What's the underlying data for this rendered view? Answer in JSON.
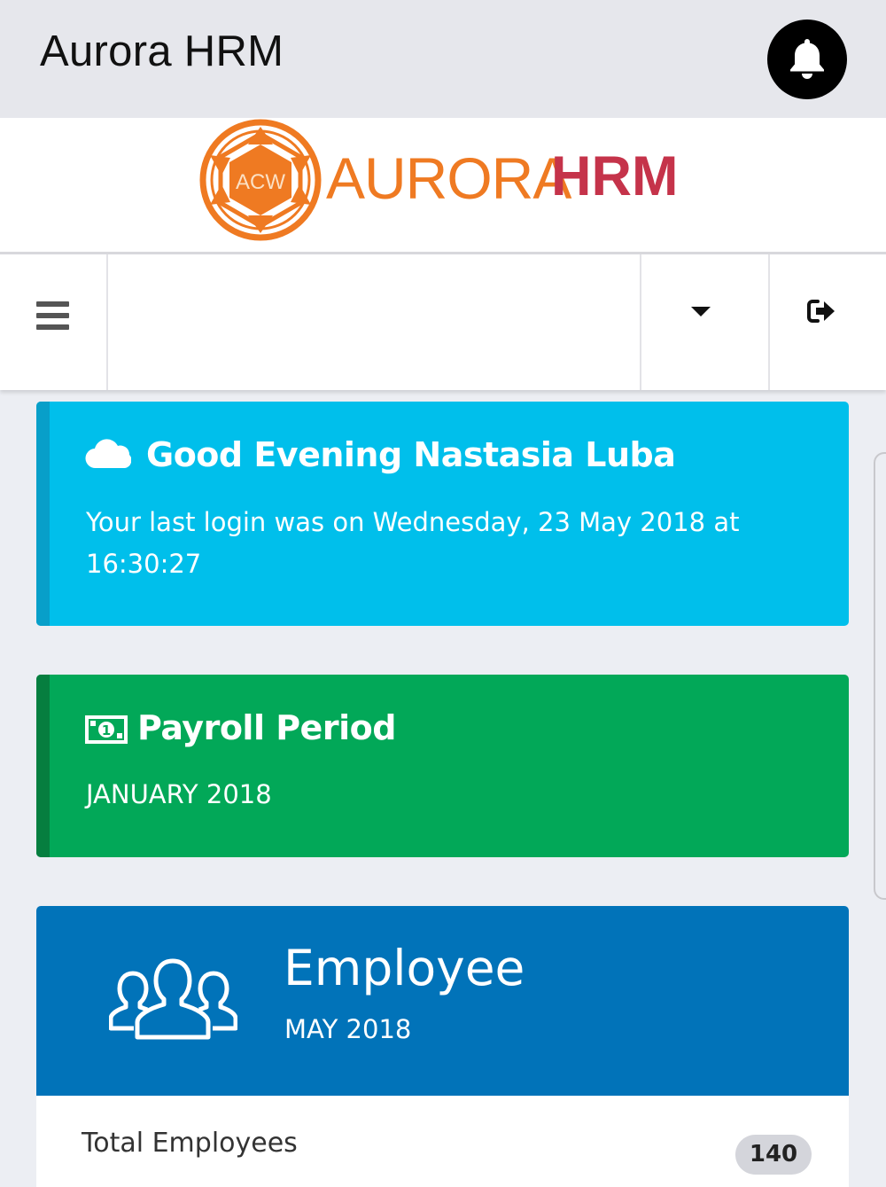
{
  "appbar": {
    "title": "Aurora HRM",
    "notification_icon": "bell-icon"
  },
  "logo": {
    "emblem_text": "ACW",
    "text_primary": "AURORA",
    "text_secondary": "HRM"
  },
  "navbar": {
    "menu_icon": "menu-icon",
    "dropdown_icon": "caret-down-icon",
    "logout_icon": "sign-out-icon"
  },
  "welcome": {
    "icon": "cloud-icon",
    "title": "Good Evening Nastasia Luba",
    "message": "Your last login was on Wednesday, 23 May 2018 at 16:30:27"
  },
  "payroll": {
    "icon": "money-icon",
    "title": "Payroll Period",
    "period": "JANUARY 2018"
  },
  "employee": {
    "icon": "users-icon",
    "title": "Employee",
    "subtitle": "MAY 2018",
    "total_label": "Total Employees",
    "total_value": "140"
  },
  "colors": {
    "welcome": "#00bfeb",
    "payroll": "#02a858",
    "employee": "#0173b9",
    "logo_orange": "#ef7a22",
    "logo_red": "#c5334a"
  }
}
